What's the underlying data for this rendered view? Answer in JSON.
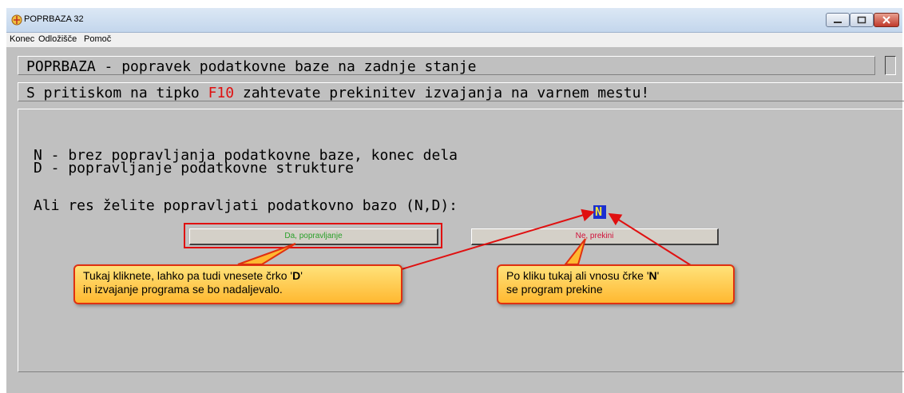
{
  "window": {
    "title": "POPRBAZA 32"
  },
  "menu": {
    "items": [
      "Konec",
      "Odložišče",
      "Pomoč"
    ]
  },
  "header": {
    "title_line": "POPRBAZA - popravek podatkovne baze na zadnje stanje",
    "info_prefix": "S pritiskom na tipko ",
    "info_key": "F10",
    "info_suffix": " zahtevate prekinitev izvajanja na varnem mestu!"
  },
  "main": {
    "option_n": "N - brez popravljanja podatkovne baze, konec dela",
    "option_d": "D - popravljanje podatkovne strukture",
    "prompt": "Ali res želite popravljati podatkovno bazo (N,D):",
    "input_value": "N"
  },
  "buttons": {
    "yes_label": "Da, popravljanje",
    "no_label": "Ne, prekini"
  },
  "callouts": {
    "left_line1_prefix": "Tukaj kliknete, lahko pa tudi vnesete črko '",
    "left_line1_key": "D",
    "left_line1_suffix": "'",
    "left_line2": "in izvajanje programa se bo nadaljevalo.",
    "right_line1_prefix": "Po kliku tukaj ali vnosu črke '",
    "right_line1_key": "N",
    "right_line1_suffix": "'",
    "right_line2": "se program prekine"
  },
  "colors": {
    "accent_red": "#e01010",
    "yes_green": "#2aa02a",
    "no_red": "#d0103a",
    "callout_fill": "#ffc850",
    "cursor_blue": "#1b2fd1"
  }
}
